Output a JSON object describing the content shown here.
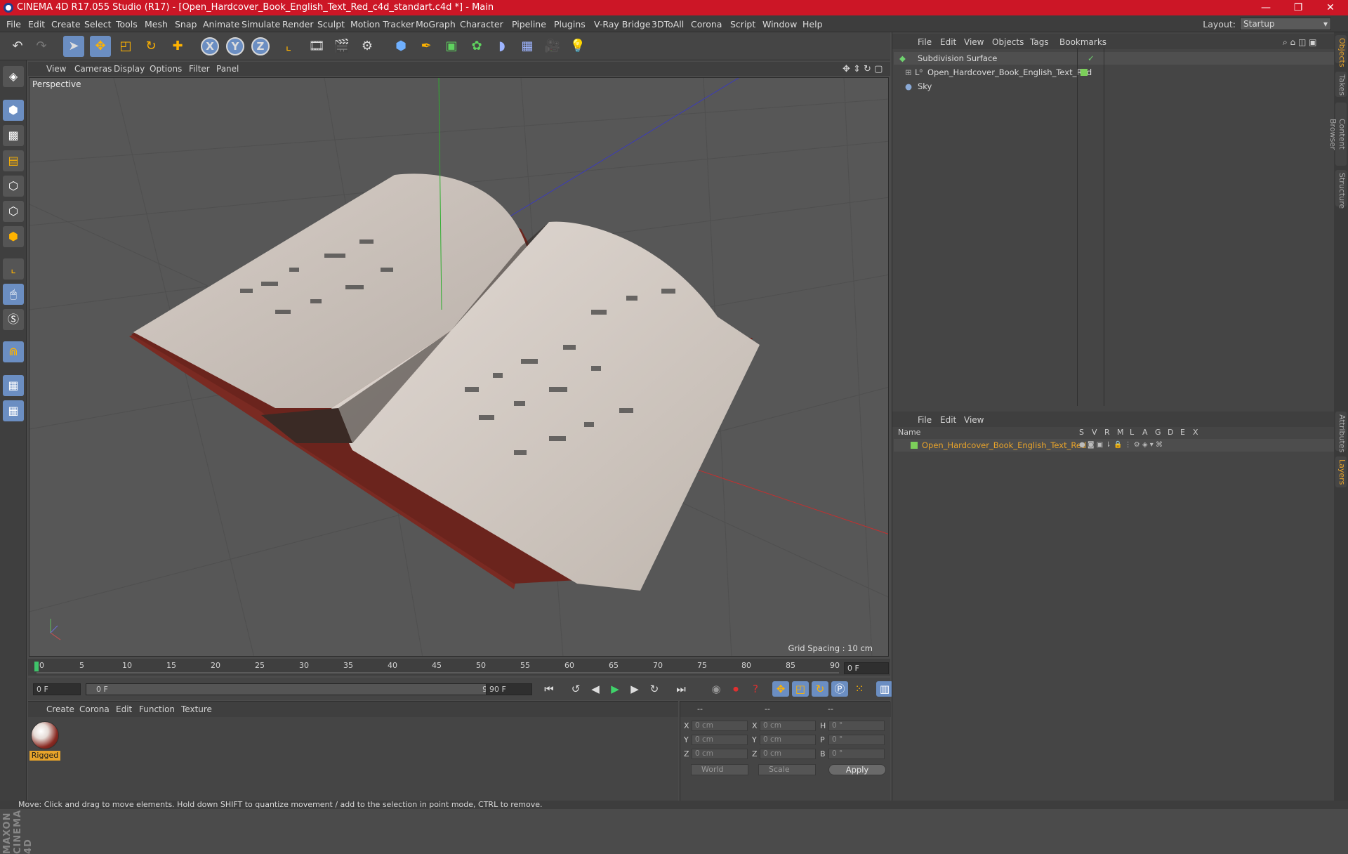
{
  "window": {
    "title": "CINEMA 4D R17.055 Studio (R17) - [Open_Hardcover_Book_English_Text_Red_c4d_standart.c4d *] - Main",
    "controls": [
      "—",
      "❐",
      "✕"
    ]
  },
  "menu": [
    "File",
    "Edit",
    "Create",
    "Select",
    "Tools",
    "Mesh",
    "Snap",
    "Animate",
    "Simulate",
    "Render",
    "Sculpt",
    "Motion Tracker",
    "MoGraph",
    "Character",
    "Pipeline",
    "Plugins",
    "V-Ray Bridge",
    "3DToAll",
    "Corona",
    "Script",
    "Window",
    "Help"
  ],
  "layout": {
    "label": "Layout:",
    "value": "Startup"
  },
  "toolbar": {
    "icons": [
      "undo-icon",
      "redo-icon",
      "select-icon",
      "move-icon",
      "scale-icon",
      "rotate-icon",
      "add-icon",
      "x-axis",
      "y-axis",
      "z-axis",
      "coordinate-icon",
      "render-view-icon",
      "render-icon",
      "render-settings-icon",
      "cube-icon",
      "pen-icon",
      "subdivide-icon",
      "cloner-icon",
      "deformer-icon",
      "floor-icon",
      "camera-icon",
      "light-icon"
    ],
    "axes": [
      "X",
      "Y",
      "Z"
    ]
  },
  "viewport": {
    "menu": [
      "View",
      "Cameras",
      "Display",
      "Options",
      "Filter",
      "Panel"
    ],
    "label": "Perspective",
    "grid_spacing": "Grid Spacing : 10 cm"
  },
  "timeline": {
    "ticks": [
      "0",
      "5",
      "10",
      "15",
      "20",
      "25",
      "30",
      "35",
      "40",
      "45",
      "50",
      "55",
      "60",
      "65",
      "70",
      "75",
      "80",
      "85",
      "90"
    ],
    "end_frame": "0 F",
    "start_field": "0 F",
    "slider_left": "0 F",
    "slider_right": "90 F",
    "max_field": "90 F"
  },
  "materials": {
    "menu": [
      "Create",
      "Corona",
      "Edit",
      "Function",
      "Texture"
    ],
    "items": [
      {
        "name": "Rigged"
      }
    ]
  },
  "coordinates": {
    "header": [
      "--",
      "--",
      "--"
    ],
    "rows": [
      {
        "a": "X",
        "av": "0 cm",
        "b": "X",
        "bv": "0 cm",
        "c": "H",
        "cv": "0 °"
      },
      {
        "a": "Y",
        "av": "0 cm",
        "b": "Y",
        "bv": "0 cm",
        "c": "P",
        "cv": "0 °"
      },
      {
        "a": "Z",
        "av": "0 cm",
        "b": "Z",
        "bv": "0 cm",
        "c": "B",
        "cv": "0 °"
      }
    ],
    "mode1": "World",
    "mode2": "Scale",
    "apply": "Apply"
  },
  "objects_panel": {
    "menu": [
      "File",
      "Edit",
      "View",
      "Objects",
      "Tags",
      "Bookmarks"
    ],
    "items": [
      {
        "name": "Subdivision Surface",
        "color": "#6fd36f"
      },
      {
        "name": "Open_Hardcover_Book_English_Text_Red",
        "color": "#7ccf5a"
      },
      {
        "name": "Sky",
        "color": "#8aa9d6"
      }
    ]
  },
  "layers_panel": {
    "menu": [
      "File",
      "Edit",
      "View"
    ],
    "columns": [
      "Name",
      "S",
      "V",
      "R",
      "M",
      "L",
      "A",
      "G",
      "D",
      "E",
      "X"
    ],
    "items": [
      {
        "name": "Open_Hardcover_Book_English_Text_Red",
        "color": "#7ccf5a"
      }
    ]
  },
  "side_tabs": [
    "Objects",
    "Takes",
    "Content Browser",
    "Structure",
    "Attributes",
    "Layers"
  ],
  "status": "Move: Click and drag to move elements. Hold down SHIFT to quantize movement / add to the selection in point mode, CTRL to remove.",
  "brand": "MAXON CINEMA 4D",
  "colors": {
    "titlebar": "#cc1626",
    "accent": "#6b8ec2",
    "highlight": "#e8a32a"
  }
}
